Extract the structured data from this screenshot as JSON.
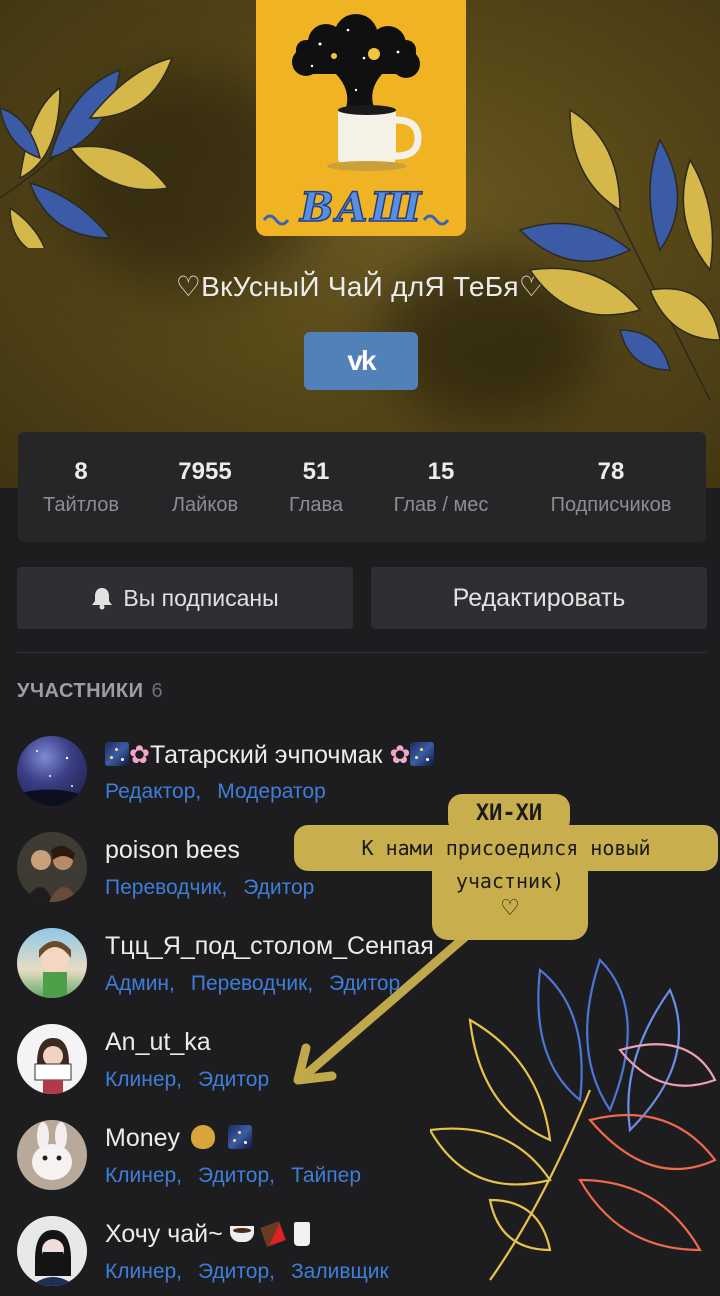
{
  "group": {
    "title": "♡ВкУсныЙ ЧаЙ длЯ ТеБя♡",
    "vk_label": "vk"
  },
  "stats": [
    {
      "value": "8",
      "label": "Тайтлов"
    },
    {
      "value": "7955",
      "label": "Лайков"
    },
    {
      "value": "51",
      "label": "Глава"
    },
    {
      "value": "15",
      "label": "Глав / мес"
    },
    {
      "value": "78",
      "label": "Подписчиков"
    }
  ],
  "buttons": {
    "subscribed": "Вы подписаны",
    "edit": "Редактировать"
  },
  "members": {
    "heading": "УЧАСТНИКИ",
    "count": "6",
    "list": [
      {
        "name": "Татарский эчпочмак",
        "roles": [
          "Редактор,",
          "Модератор"
        ]
      },
      {
        "name": "poison bees",
        "roles": [
          "Переводчик,",
          "Эдитор"
        ]
      },
      {
        "name": "Тцц_Я_под_столом_Сенпая",
        "roles": [
          "Админ,",
          "Переводчик,",
          "Эдитор"
        ]
      },
      {
        "name": "An_ut_ka",
        "roles": [
          "Клинер,",
          "Эдитор"
        ]
      },
      {
        "name": "Money",
        "roles": [
          "Клинер,",
          "Эдитор,",
          "Тайпер"
        ]
      },
      {
        "name": "Хочу чай~",
        "roles": [
          "Клинер,",
          "Эдитор,",
          "Заливщик"
        ]
      }
    ]
  },
  "stickers": {
    "brand": "ВАШ",
    "note_title": "ХИ-ХИ",
    "note_line1": "К нами присоедился новый",
    "note_line2": "участник)",
    "note_heart": "♡"
  },
  "colors": {
    "accent_blue": "#3d7fd8",
    "vk_blue": "#5181b8",
    "cover_yellow": "#f0b323"
  }
}
